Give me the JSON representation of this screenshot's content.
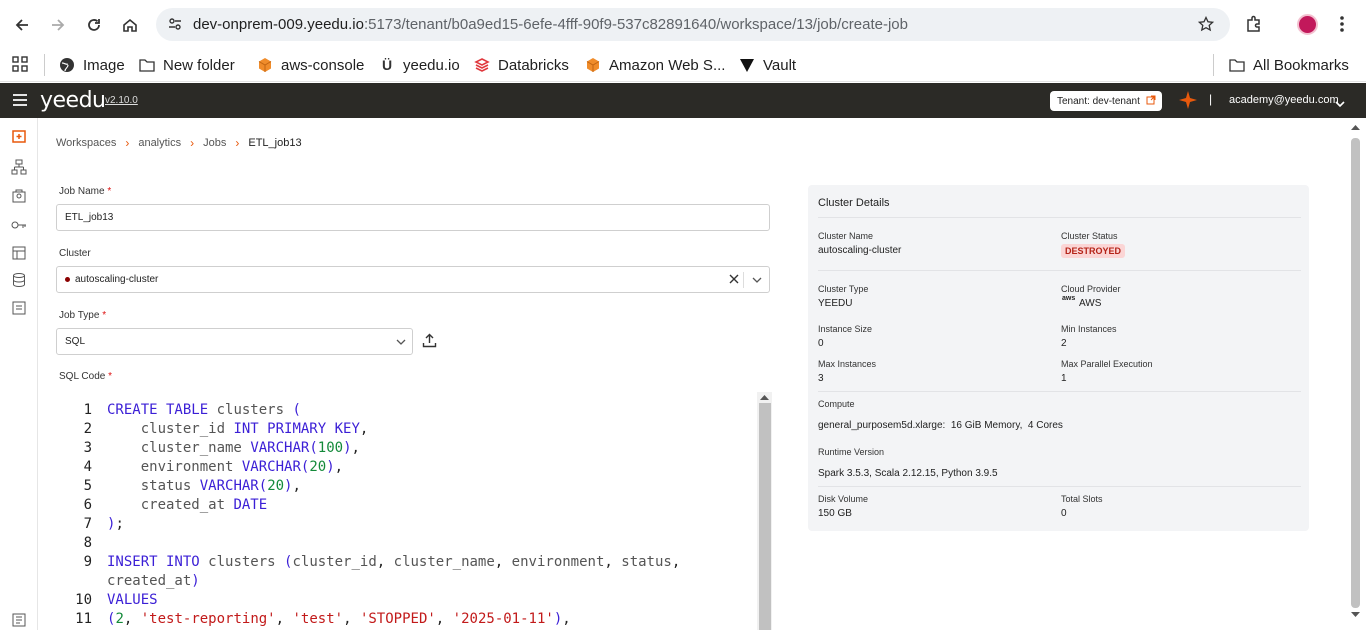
{
  "browser": {
    "url_host": "dev-onprem-009.yeedu.io",
    "url_path": ":5173/tenant/b0a9ed15-6efe-4fff-90f9-537c82891640/workspace/13/job/create-job",
    "bookmarks": [
      "Image",
      "New folder",
      "aws-console",
      "yeedu.io",
      "Databricks",
      "Amazon Web S...",
      "Vault"
    ],
    "all_bookmarks": "All Bookmarks"
  },
  "header": {
    "logo": "yeedu",
    "version": "v2.10.0",
    "tenant_label": "Tenant:",
    "tenant_value": "dev-tenant",
    "user": "academy@yeedu.com",
    "separator": "|"
  },
  "breadcrumb": [
    "Workspaces",
    "analytics",
    "Jobs",
    "ETL_job13"
  ],
  "form": {
    "job_name_label": "Job Name",
    "job_name_value": "ETL_job13",
    "cluster_label": "Cluster",
    "cluster_value": "autoscaling-cluster",
    "job_type_label": "Job Type",
    "job_type_value": "SQL",
    "sql_code_label": "SQL Code",
    "required_mark": "*"
  },
  "code": {
    "line_numbers": [
      "1",
      "2",
      "3",
      "4",
      "5",
      "6",
      "7",
      "8",
      "9",
      "",
      "10",
      "11"
    ]
  },
  "cluster_details": {
    "title": "Cluster Details",
    "cluster_name_label": "Cluster Name",
    "cluster_name": "autoscaling-cluster",
    "cluster_status_label": "Cluster Status",
    "cluster_status": "DESTROYED",
    "cluster_type_label": "Cluster Type",
    "cluster_type": "YEEDU",
    "cloud_provider_label": "Cloud Provider",
    "cloud_provider": "AWS",
    "cloud_logo_text": "aws",
    "instance_size_label": "Instance Size",
    "instance_size": "0",
    "min_instances_label": "Min Instances",
    "min_instances": "2",
    "max_instances_label": "Max Instances",
    "max_instances": "3",
    "max_parallel_label": "Max Parallel Execution",
    "max_parallel": "1",
    "compute_label": "Compute",
    "compute": "general_purposem5d.xlarge:  16 GiB Memory,  4 Cores",
    "runtime_label": "Runtime Version",
    "runtime": "Spark 3.5.3, Scala 2.12.15, Python 3.9.5",
    "disk_label": "Disk Volume",
    "disk": "150 GB",
    "slots_label": "Total Slots",
    "slots": "0"
  },
  "colors": {
    "accent": "#e8590c",
    "header_bg": "#2b2a26",
    "keyword": "#3b1fd6",
    "string": "#c21a1a",
    "number": "#148a3a"
  }
}
